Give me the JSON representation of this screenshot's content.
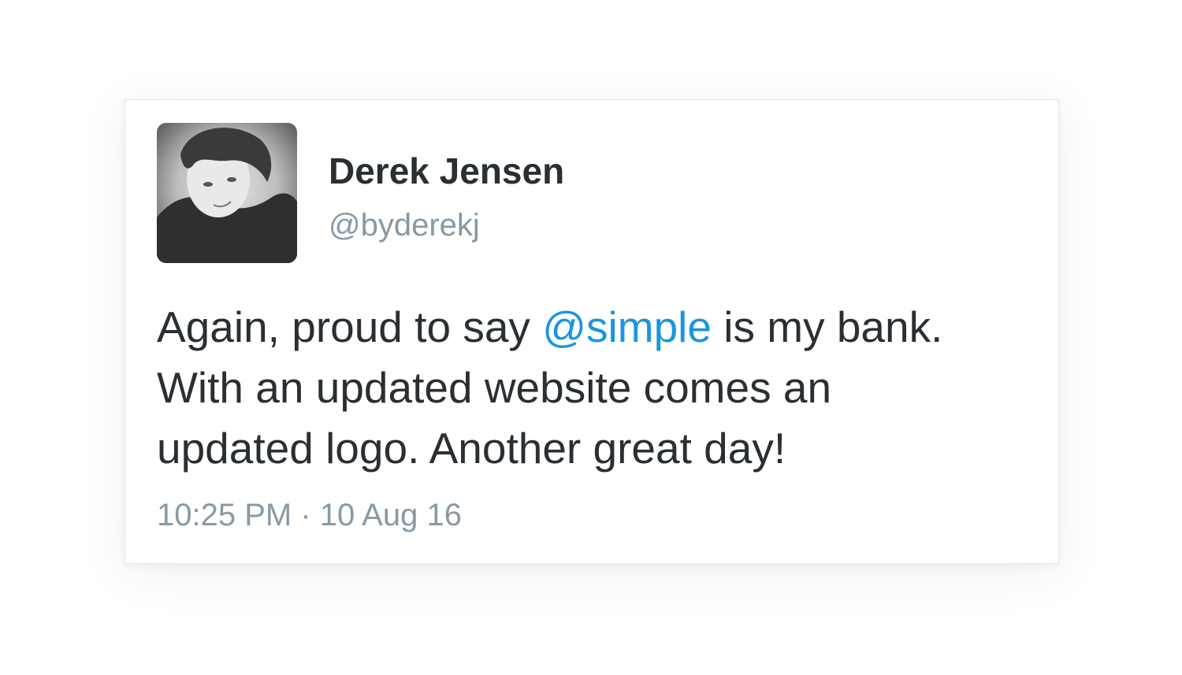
{
  "tweet": {
    "author": {
      "name": "Derek Jensen",
      "handle": "@byderekj"
    },
    "text": {
      "line1_before": "Again, proud to say ",
      "mention": "@simple",
      "line1_after": " is my bank.",
      "line2": "With an updated website comes an",
      "line3": "updated logo. Another great day!"
    },
    "time": "10:25 PM",
    "separator": " · ",
    "date": "10 Aug 16"
  },
  "colors": {
    "text": "#292f33",
    "secondary": "#8899a6",
    "link": "#1b95e0"
  }
}
